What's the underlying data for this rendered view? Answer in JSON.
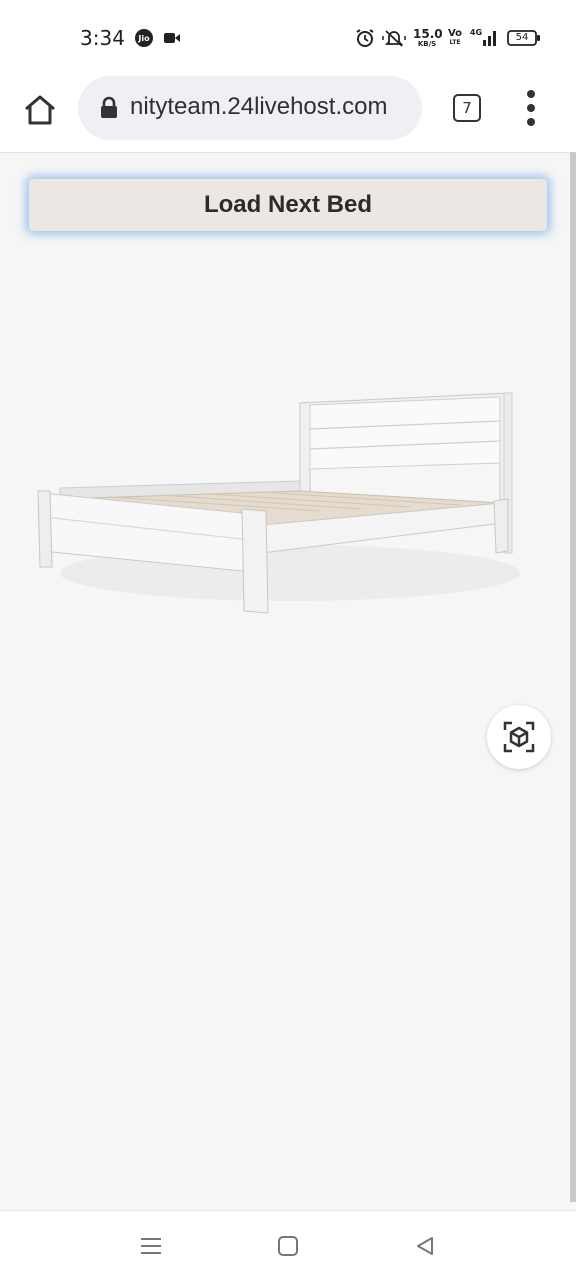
{
  "status_bar": {
    "time": "3:34",
    "net_speed_value": "15.0",
    "net_speed_unit": "KB/S",
    "volte_top": "Vo",
    "volte_bottom": "LTE",
    "network": "4G",
    "battery": "54",
    "icons": [
      "jio-icon",
      "video-record-icon",
      "alarm-icon",
      "mute-icon",
      "signal-icon",
      "battery-icon"
    ]
  },
  "browser": {
    "url": "nityteam.24livehost.com",
    "tab_count": "7"
  },
  "page": {
    "load_button_label": "Load Next Bed",
    "viewer_model": "white-wooden-bed"
  },
  "navigation": {
    "buttons": [
      "menu-nav-icon",
      "home-nav-icon",
      "back-nav-icon"
    ]
  },
  "colors": {
    "button_bg": "#ece7e3",
    "button_glow": "#4696e6",
    "page_bg": "#f6f6f6"
  }
}
